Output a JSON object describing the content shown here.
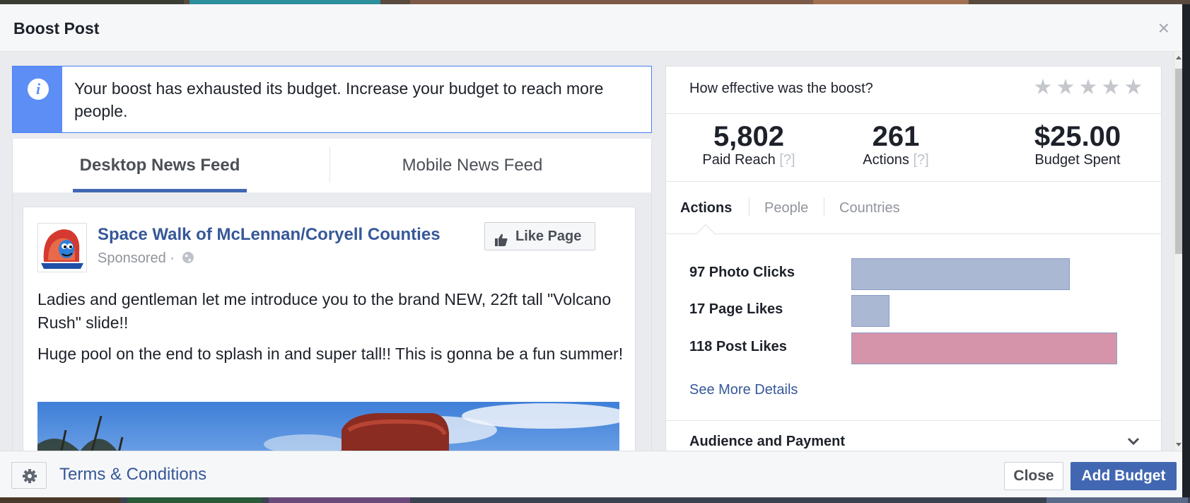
{
  "dialog": {
    "title": "Boost Post",
    "close_icon": "close-icon"
  },
  "notice": {
    "icon": "info-icon",
    "text": "Your boost has exhausted its budget. Increase your budget to reach more people."
  },
  "preview_tabs": [
    {
      "label": "Desktop News Feed",
      "active": true
    },
    {
      "label": "Mobile News Feed",
      "active": false
    }
  ],
  "post": {
    "page_name": "Space Walk of McLennan/Coryell Counties",
    "sponsored": "Sponsored ·",
    "like_button": "Like Page",
    "paragraphs": [
      "Ladies and gentleman let me introduce you to the brand NEW, 22ft tall \"Volcano Rush\" slide!!",
      "Huge pool on the end to splash in and super tall!! This is gonna be a fun summer!"
    ]
  },
  "rating": {
    "question": "How effective was the boost?",
    "stars": 5
  },
  "stats": [
    {
      "value": "5,802",
      "label": "Paid Reach",
      "help": "[?]"
    },
    {
      "value": "261",
      "label": "Actions",
      "help": "[?]"
    },
    {
      "value": "$25.00",
      "label": "Budget Spent",
      "help": ""
    }
  ],
  "sub_tabs": [
    {
      "label": "Actions",
      "active": true
    },
    {
      "label": "People",
      "active": false
    },
    {
      "label": "Countries",
      "active": false
    }
  ],
  "actions": [
    {
      "label": "97 Photo Clicks",
      "value": 97,
      "color": "#abb8d4"
    },
    {
      "label": "17 Page Likes",
      "value": 17,
      "color": "#abb8d4"
    },
    {
      "label": "118 Post Likes",
      "value": 118,
      "color": "#d594a9"
    }
  ],
  "see_more": "See More Details",
  "audience": {
    "label": "Audience and Payment"
  },
  "footer": {
    "terms": "Terms & Conditions",
    "close": "Close",
    "add_budget": "Add Budget"
  },
  "colors": {
    "brand": "#4267b2",
    "link": "#365899",
    "info": "#5d8ef5"
  }
}
